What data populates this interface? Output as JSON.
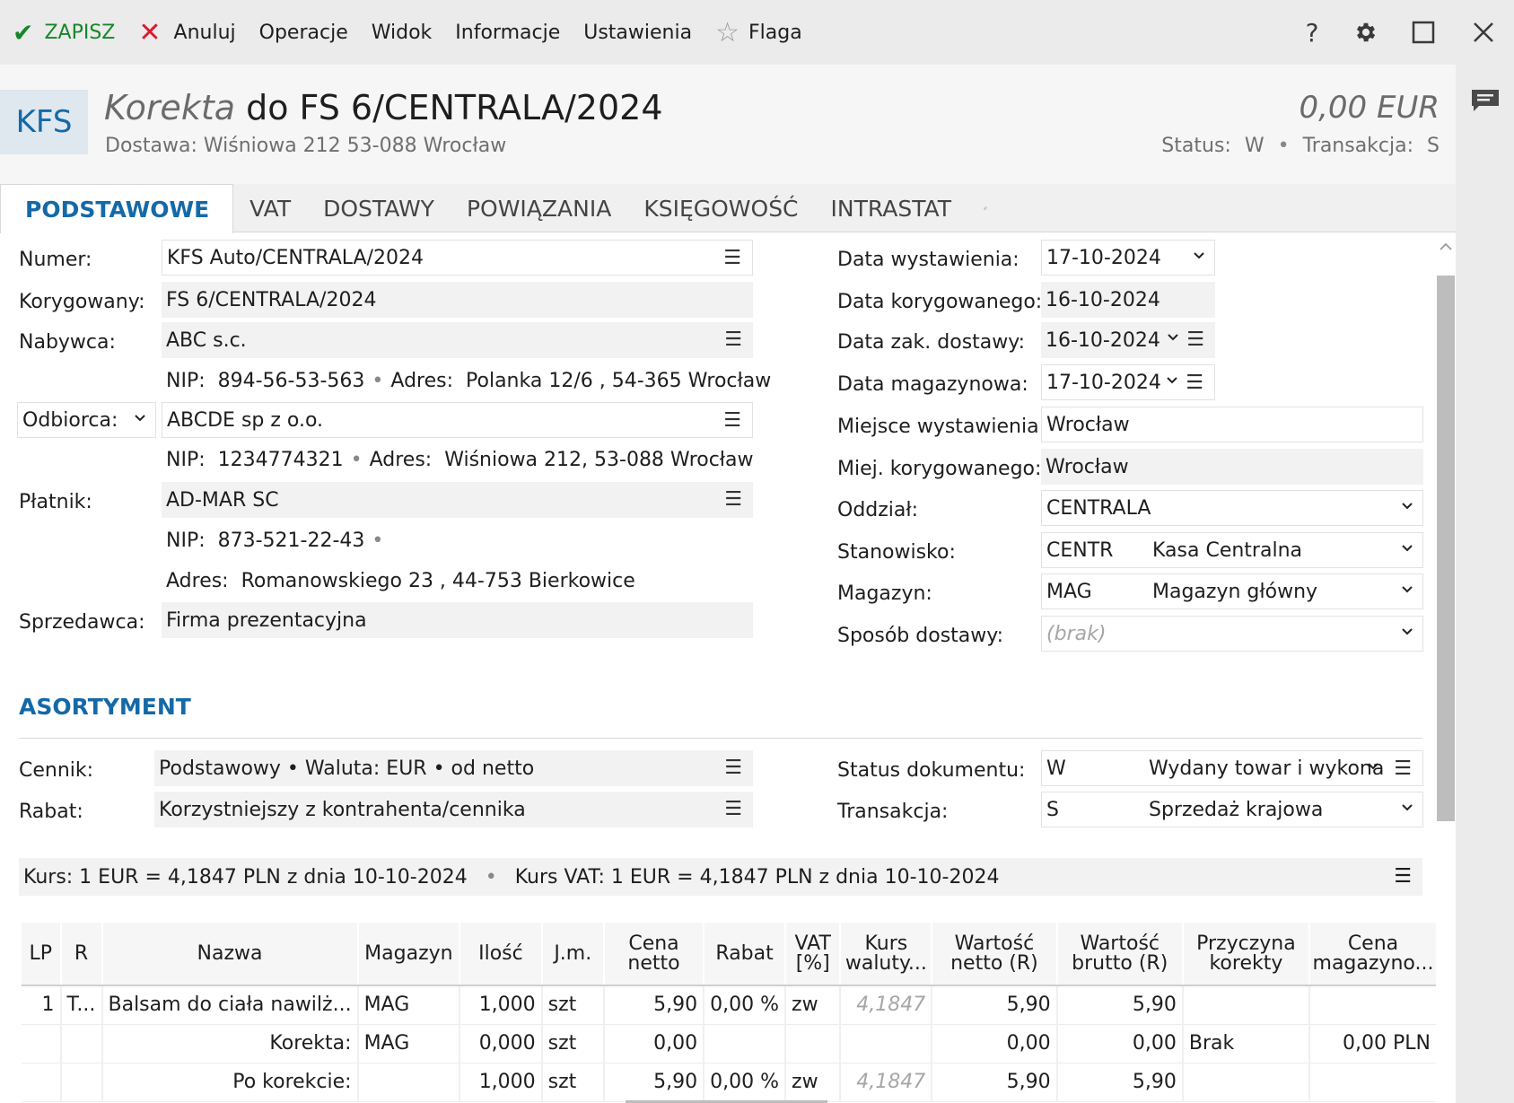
{
  "menu": {
    "save": "ZAPISZ",
    "cancel": "Anuluj",
    "operations": "Operacje",
    "view": "Widok",
    "info": "Informacje",
    "settings": "Ustawienia",
    "flag": "Flaga",
    "help": "?"
  },
  "header": {
    "badge": "KFS",
    "title_italic": "Korekta",
    "title_rest": " do FS 6/CENTRALA/2024",
    "subtitle": "Dostawa: Wiśniowa 212 53-088 Wrocław",
    "amount": "0,00 EUR",
    "status_label": "Status:",
    "status_value": "W",
    "transaction_label": "Transakcja:",
    "transaction_value": "S"
  },
  "tabs": [
    "PODSTAWOWE",
    "VAT",
    "DOSTAWY",
    "POWIĄZANIA",
    "KSIĘGOWOŚĆ",
    "INTRASTAT"
  ],
  "left": {
    "numer_label": "Numer:",
    "numer_value": "KFS Auto/CENTRALA/2024",
    "korygowany_label": "Korygowany:",
    "korygowany_value": "FS 6/CENTRALA/2024",
    "nabywca_label": "Nabywca:",
    "nabywca_value": "ABC s.c.",
    "nabywca_nip_label": "NIP:",
    "nabywca_nip": "894-56-53-563",
    "nabywca_adres_label": "Adres:",
    "nabywca_adres": "Polanka  12/6 , 54-365 Wrocław",
    "odbiorca_label": "Odbiorca:",
    "odbiorca_value": "ABCDE sp z o.o.",
    "odbiorca_nip_label": "NIP:",
    "odbiorca_nip": "1234774321",
    "odbiorca_adres_label": "Adres:",
    "odbiorca_adres": "Wiśniowa 212, 53-088 Wrocław",
    "platnik_label": "Płatnik:",
    "platnik_value": "AD-MAR SC",
    "platnik_nip_label": "NIP:",
    "platnik_nip": "873-521-22-43",
    "platnik_adres_label": "Adres:",
    "platnik_adres": "Romanowskiego 23 , 44-753 Bierkowice",
    "sprzedawca_label": "Sprzedawca:",
    "sprzedawca_value": "Firma prezentacyjna"
  },
  "right": {
    "data_wyst_label": "Data wystawienia:",
    "data_wyst_value": "17-10-2024",
    "data_kor_label": "Data korygowanego:",
    "data_kor_value": "16-10-2024",
    "data_dost_label": "Data zak. dostawy:",
    "data_dost_value": "16-10-2024",
    "data_mag_label": "Data magazynowa:",
    "data_mag_value": "17-10-2024",
    "miejsce_label": "Miejsce wystawienia:",
    "miejsce_value": "Wrocław",
    "miej_kor_label": "Miej. korygowanego:",
    "miej_kor_value": "Wrocław",
    "oddzial_label": "Oddział:",
    "oddzial_value": "CENTRALA",
    "stanowisko_label": "Stanowisko:",
    "stanowisko_code": "CENTR",
    "stanowisko_name": "Kasa Centralna",
    "magazyn_label": "Magazyn:",
    "magazyn_code": "MAG",
    "magazyn_name": "Magazyn główny",
    "sposob_label": "Sposób dostawy:",
    "sposob_value": "(brak)"
  },
  "asortyment": {
    "title": "ASORTYMENT",
    "cennik_label": "Cennik:",
    "cennik_value": "Podstawowy • Waluta: EUR • od netto",
    "rabat_label": "Rabat:",
    "rabat_value": "Korzystniejszy z kontrahenta/cennika",
    "status_doc_label": "Status dokumentu:",
    "status_doc_code": "W",
    "status_doc_name": "Wydany towar i wykona",
    "transakcja_label": "Transakcja:",
    "transakcja_code": "S",
    "transakcja_name": "Sprzedaż krajowa",
    "kurs": "Kurs: 1 EUR = 4,1847 PLN z dnia 10-10-2024",
    "kurs_vat": "Kurs VAT: 1 EUR = 4,1847 PLN z dnia 10-10-2024"
  },
  "grid": {
    "headers": [
      "LP",
      "R",
      "Nazwa",
      "Magazyn",
      "Ilość",
      "J.m.",
      "Cena netto",
      "Rabat",
      "VAT [%]",
      "Kurs waluty...",
      "Wartość netto (R)",
      "Wartość brutto (R)",
      "Przyczyna korekty",
      "Cena magazyno..."
    ],
    "rows": [
      [
        "1",
        "T...",
        "Balsam do ciała nawilż...",
        "MAG",
        "1,000",
        "szt",
        "5,90",
        "0,00 %",
        "zw",
        "4,1847",
        "5,90",
        "5,90",
        "",
        ""
      ],
      [
        "",
        "",
        "Korekta:",
        "MAG",
        "0,000",
        "szt",
        "0,00",
        "",
        "",
        "",
        "0,00",
        "0,00",
        "Brak",
        "0,00 PLN"
      ],
      [
        "",
        "",
        "Po korekcie:",
        "",
        "1,000",
        "szt",
        "5,90",
        "0,00 %",
        "zw",
        "4,1847",
        "5,90",
        "5,90",
        "",
        ""
      ]
    ]
  },
  "colors": {
    "accent": "#1469a8",
    "save": "#17862a",
    "cancel": "#e0182b"
  }
}
